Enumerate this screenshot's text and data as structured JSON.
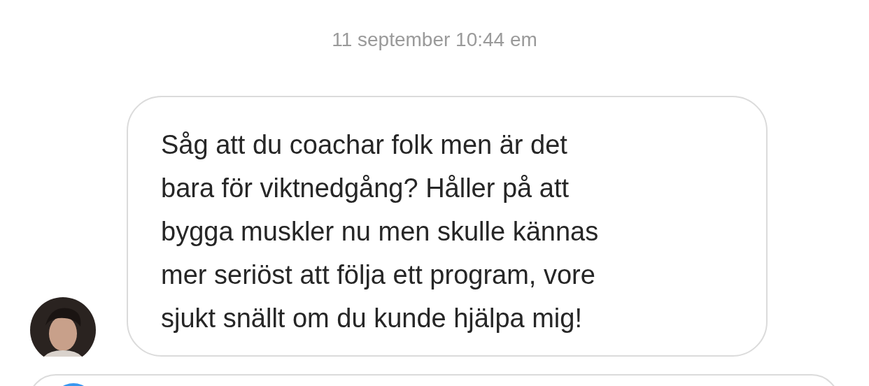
{
  "timestamp": "11 september 10:44 em",
  "message": {
    "text": "Såg att du coachar folk men är det\nbara för viktnedgång? Håller på att\nbygga muskler nu men skulle kännas\nmer seriöst att följa ett program, vore\nsjukt snällt om du kunde hjälpa mig!"
  }
}
